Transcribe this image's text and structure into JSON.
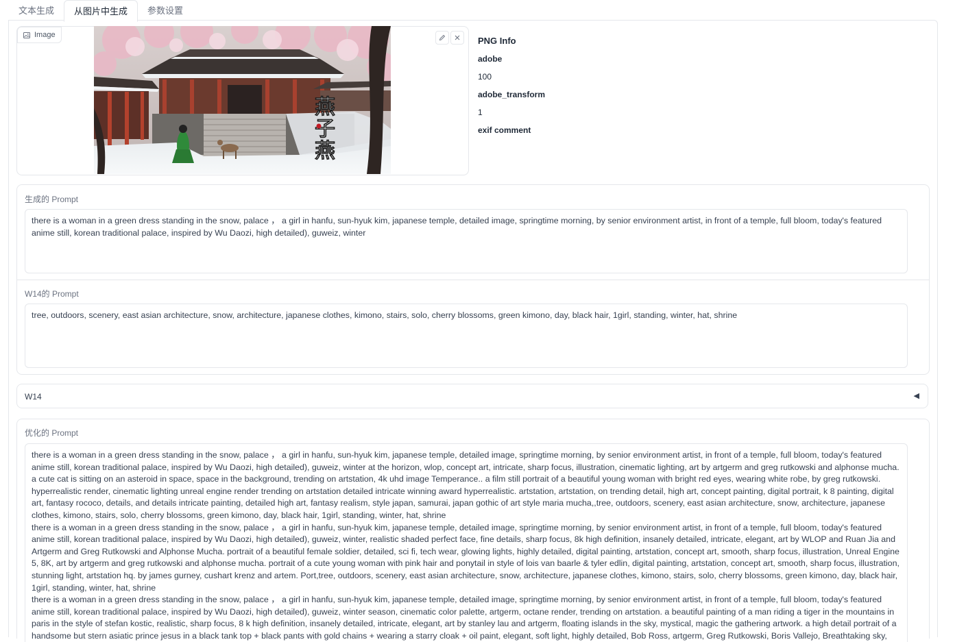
{
  "tabs": [
    {
      "label": "文本生成"
    },
    {
      "label": "从图片中生成"
    },
    {
      "label": "参数设置"
    }
  ],
  "image_panel": {
    "label": "Image",
    "edit_icon": "pencil-icon",
    "close_icon": "close-icon",
    "image_calligraphy": "燕子燕"
  },
  "png_info": {
    "title": "PNG Info",
    "rows": [
      {
        "key": "adobe",
        "value": "100"
      },
      {
        "key": "adobe_transform",
        "value": "1"
      },
      {
        "key": "exif comment",
        "value": ""
      }
    ]
  },
  "generated_prompt": {
    "label": "生成的 Prompt",
    "value": "there is a woman in a green dress standing in the snow, palace ， a girl in hanfu, sun-hyuk kim, japanese temple, detailed image, springtime morning, by senior environment artist, in front of a temple, full bloom, today's featured anime still, korean traditional palace, inspired by Wu Daozi, high detailed), guweiz, winter"
  },
  "w14_prompt": {
    "label": "W14的 Prompt",
    "value": "tree, outdoors, scenery, east asian architecture, snow, architecture, japanese clothes, kimono, stairs, solo, cherry blossoms, green kimono, day, black hair, 1girl, standing, winter, hat, shrine"
  },
  "w14_accordion": {
    "label": "W14",
    "arrow": "◀"
  },
  "optimized_prompt": {
    "label": "优化的 Prompt",
    "paragraphs": [
      "there is a woman in a green dress standing in the snow, palace ， a girl in hanfu, sun-hyuk kim, japanese temple, detailed image, springtime morning, by senior environment artist, in front of a temple, full bloom, today's featured anime still, korean traditional palace, inspired by Wu Daozi, high detailed), guweiz, winter at the horizon, wlop, concept art, intricate, sharp focus, illustration, cinematic lighting, art by artgerm and greg rutkowski and alphonse mucha. a cute cat is sitting on an asteroid in space, space in the background, trending on artstation, 4k uhd image Temperance.. a film still portrait of a beautiful young woman with bright red eyes, wearing white robe, by greg rutkowski. hyperrealistic render, cinematic lighting unreal engine render trending on artstation detailed intricate winning award hyperrealistic. artstation, artstation, on trending detail, high art, concept painting, digital portrait, k 8 painting, digital art, fantasy rococo, details, and details intricate painting, detailed high art, fantasy realism, style japan, samurai, japan gothic of art style maria mucha,,tree, outdoors, scenery, east asian architecture, snow, architecture, japanese clothes, kimono, stairs, solo, cherry blossoms, green kimono, day, black hair, 1girl, standing, winter, hat, shrine",
      "there is a woman in a green dress standing in the snow, palace ， a girl in hanfu, sun-hyuk kim, japanese temple, detailed image, springtime morning, by senior environment artist, in front of a temple, full bloom, today's featured anime still, korean traditional palace, inspired by Wu Daozi, high detailed), guweiz, winter, realistic shaded perfect face, fine details, sharp focus, 8k high definition, insanely detailed, intricate, elegant, art by WLOP and Ruan Jia and Artgerm and Greg Rutkowski and Alphonse Mucha. portrait of a beautiful female soldier, detailed, sci fi, tech wear, glowing lights, highly detailed, digital painting, artstation, concept art, smooth, sharp focus, illustration, Unreal Engine 5, 8K, art by artgerm and greg rutkowski and alphonse mucha. portrait of a cute young woman with pink hair and ponytail in style of lois van baarle & tyler edlin, digital painting, artstation, concept art, smooth, sharp focus, illustration, stunning light, artstation hq. by james gurney, cushart krenz and artem. Port,tree, outdoors, scenery, east asian architecture, snow, architecture, japanese clothes, kimono, stairs, solo, cherry blossoms, green kimono, day, black hair, 1girl, standing, winter, hat, shrine",
      "there is a woman in a green dress standing in the snow, palace ， a girl in hanfu, sun-hyuk kim, japanese temple, detailed image, springtime morning, by senior environment artist, in front of a temple, full bloom, today's featured anime still, korean traditional palace, inspired by Wu Daozi, high detailed), guweiz, winter season, cinematic color palette, artgerm, octane render, trending on artstation. a beautiful painting of a man riding a tiger in the mountains in paris in the style of stefan kostic, realistic, sharp focus, 8 k high definition, insanely detailed, intricate, elegant, art by stanley lau and artgerm, floating islands in the sky, mystical, magic the gathering artwork. a high detail portrait of a handsome but stern asiatic prince jesus in a black tank top + black pants with gold chains + wearing a starry cloak + oil paint, elegant, soft light, highly detailed, Bob Ross, artgerm, Greg Rutkowski, Boris Vallejo, Breathtaking sky, ultra realistic, detailed by vladimir volegov and artgerm and"
    ]
  }
}
